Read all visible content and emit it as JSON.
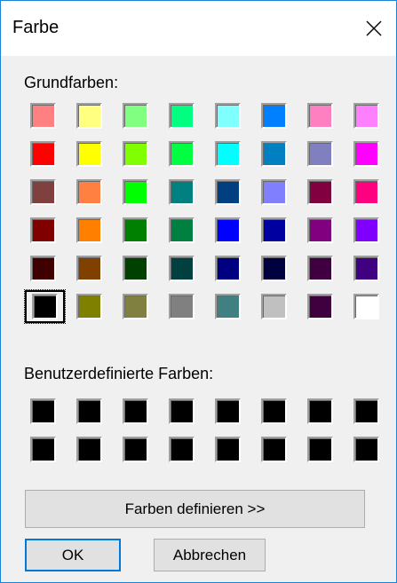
{
  "dialog": {
    "title": "Farbe",
    "close_icon": "close-icon"
  },
  "basic_colors": {
    "label": "Grundfarben:",
    "selected_index": 40,
    "colors": [
      "#ff8080",
      "#ffff80",
      "#80ff80",
      "#00ff80",
      "#80ffff",
      "#0080ff",
      "#ff80c0",
      "#ff80ff",
      "#ff0000",
      "#ffff00",
      "#80ff00",
      "#00ff40",
      "#00ffff",
      "#0080c0",
      "#8080c0",
      "#ff00ff",
      "#804040",
      "#ff8040",
      "#00ff00",
      "#008080",
      "#004080",
      "#8080ff",
      "#800040",
      "#ff0080",
      "#800000",
      "#ff8000",
      "#008000",
      "#008040",
      "#0000ff",
      "#0000a0",
      "#800080",
      "#8000ff",
      "#400000",
      "#804000",
      "#004000",
      "#004040",
      "#000080",
      "#000040",
      "#400040",
      "#400080",
      "#000000",
      "#808000",
      "#808040",
      "#808080",
      "#408080",
      "#c0c0c0",
      "#400040",
      "#ffffff"
    ]
  },
  "custom_colors": {
    "label": "Benutzerdefinierte Farben:",
    "colors": [
      "#000000",
      "#000000",
      "#000000",
      "#000000",
      "#000000",
      "#000000",
      "#000000",
      "#000000",
      "#000000",
      "#000000",
      "#000000",
      "#000000",
      "#000000",
      "#000000",
      "#000000",
      "#000000"
    ]
  },
  "buttons": {
    "define_colors": "Farben definieren >>",
    "ok": "OK",
    "cancel": "Abbrechen"
  },
  "accent_color": "#0078d7"
}
